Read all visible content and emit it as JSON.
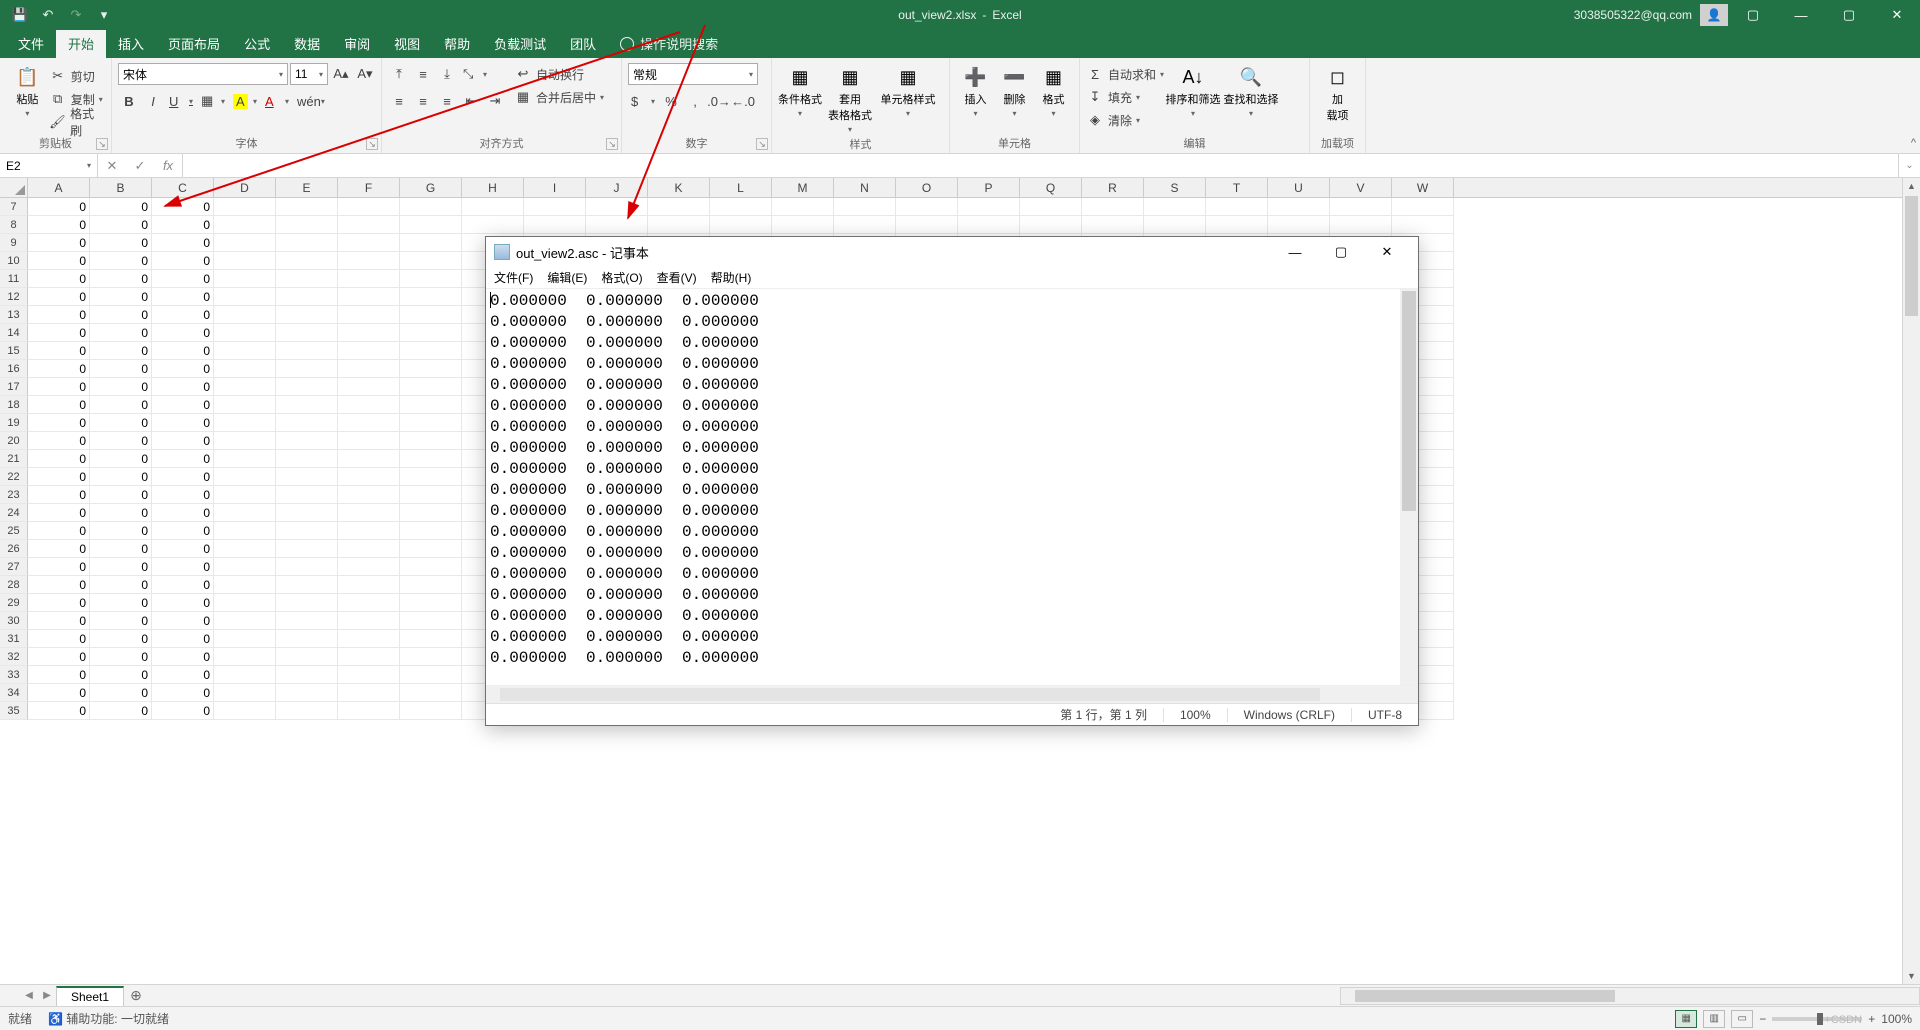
{
  "title": {
    "filename": "out_view2.xlsx",
    "app": "Excel"
  },
  "account": "3038505322@qq.com",
  "qat": {
    "save": "💾",
    "undo": "↶",
    "redo": "↷",
    "more": "▾"
  },
  "tabs": [
    "文件",
    "开始",
    "插入",
    "页面布局",
    "公式",
    "数据",
    "审阅",
    "视图",
    "帮助",
    "负载测试",
    "团队"
  ],
  "active_tab_index": 1,
  "tell_me": "操作说明搜索",
  "ribbon": {
    "clipboard": {
      "label": "剪贴板",
      "paste": "粘贴",
      "cut": "剪切",
      "copy": "复制",
      "painter": "格式刷"
    },
    "font": {
      "label": "字体",
      "name": "宋体",
      "size": "11",
      "bold": "B",
      "italic": "I",
      "underline": "U"
    },
    "align": {
      "label": "对齐方式",
      "wrap": "自动换行",
      "merge": "合并后居中"
    },
    "number": {
      "label": "数字",
      "format": "常规"
    },
    "styles": {
      "label": "样式",
      "cond": "条件格式",
      "tbl": "套用\n表格格式",
      "cell": "单元格样式"
    },
    "cells": {
      "label": "单元格",
      "insert": "插入",
      "delete": "删除",
      "format": "格式"
    },
    "editing": {
      "label": "编辑",
      "sum": "自动求和",
      "fill": "填充",
      "clear": "清除",
      "sort": "排序和筛选",
      "find": "查找和选择"
    },
    "addins": {
      "label": "加载项",
      "btn": "加\n载项"
    }
  },
  "namebox": "E2",
  "columns": [
    "A",
    "B",
    "C",
    "D",
    "E",
    "F",
    "G",
    "H",
    "I",
    "J",
    "K",
    "L",
    "M",
    "N",
    "O",
    "P",
    "Q",
    "R",
    "S",
    "T",
    "U",
    "V",
    "W"
  ],
  "first_row": 7,
  "last_row": 35,
  "cell_value": "0",
  "sheet": {
    "name": "Sheet1"
  },
  "status": {
    "ready": "就绪",
    "acc": "辅助功能: 一切就绪",
    "zoom": "100%"
  },
  "notepad": {
    "title": "out_view2.asc - 记事本",
    "menu": [
      "文件(F)",
      "编辑(E)",
      "格式(O)",
      "查看(V)",
      "帮助(H)"
    ],
    "line": "0.000000  0.000000  0.000000",
    "line_count": 18,
    "status": {
      "pos": "第 1 行，第 1 列",
      "zoom": "100%",
      "eol": "Windows (CRLF)",
      "enc": "UTF-8"
    }
  },
  "watermark": "+CSDN"
}
